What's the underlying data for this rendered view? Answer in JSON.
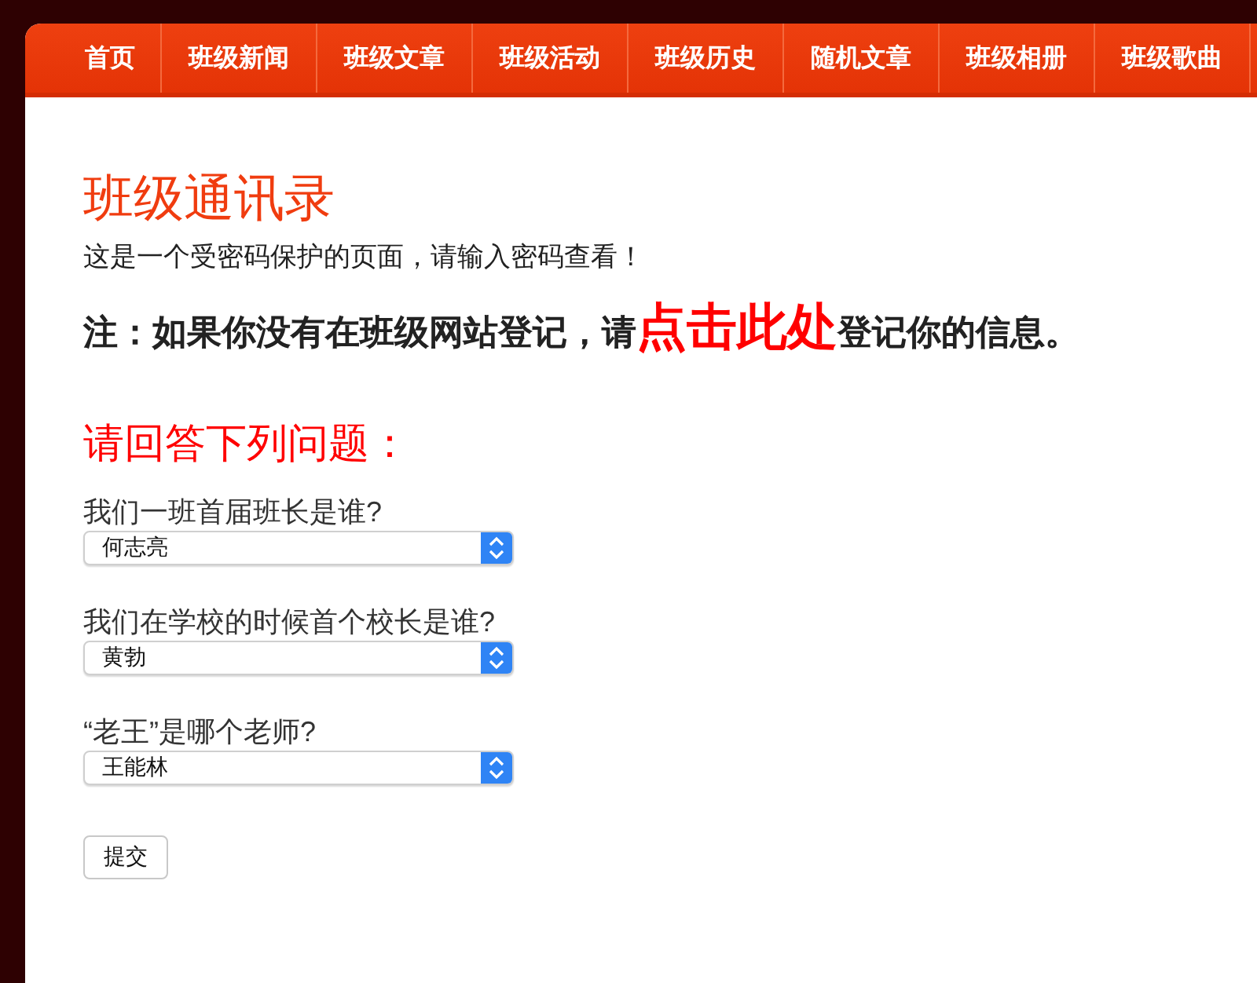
{
  "nav": [
    {
      "label": "首页"
    },
    {
      "label": "班级新闻"
    },
    {
      "label": "班级文章"
    },
    {
      "label": "班级活动"
    },
    {
      "label": "班级历史"
    },
    {
      "label": "随机文章"
    },
    {
      "label": "班级相册"
    },
    {
      "label": "班级歌曲"
    }
  ],
  "title": "班级通讯录",
  "intro": "这是一个受密码保护的页面，请输入密码查看！",
  "note": {
    "before": "注：如果你没有在班级网站登记，请",
    "link": "点击此处",
    "after": "登记你的信息。"
  },
  "quiz_heading": "请回答下列问题：",
  "questions": [
    {
      "label": "我们一班首届班长是谁?",
      "value": "何志亮"
    },
    {
      "label": "我们在学校的时候首个校长是谁?",
      "value": "黄勃"
    },
    {
      "label": "“老王”是哪个老师?",
      "value": "王能林"
    }
  ],
  "submit": "提交"
}
